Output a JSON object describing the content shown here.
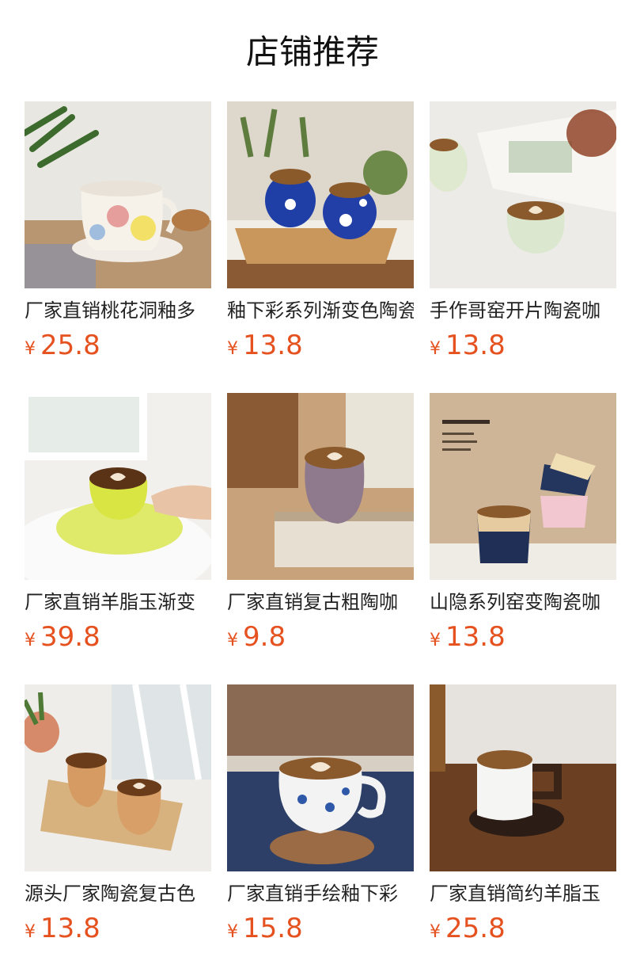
{
  "section": {
    "title": "店铺推荐"
  },
  "currency_symbol": "¥",
  "products": [
    {
      "name": "厂家直销桃花洞釉多",
      "price": "25.8",
      "image": "rainbow-mug-photo"
    },
    {
      "name": "釉下彩系列渐变色陶瓷",
      "price": "13.8",
      "image": "blue-flower-cups-photo"
    },
    {
      "name": "手作哥窑开片陶瓷咖",
      "price": "13.8",
      "image": "celadon-cup-photo"
    },
    {
      "name": "厂家直销羊脂玉渐变",
      "price": "39.8",
      "image": "yellow-cup-saucer-photo"
    },
    {
      "name": "厂家直销复古粗陶咖",
      "price": "9.8",
      "image": "purple-pot-cup-photo"
    },
    {
      "name": "山隐系列窑变陶瓷咖",
      "price": "13.8",
      "image": "stacked-gradient-cups-photo"
    },
    {
      "name": "源头厂家陶瓷复古色",
      "price": "13.8",
      "image": "wooden-tray-cups-photo"
    },
    {
      "name": "厂家直销手绘釉下彩",
      "price": "15.8",
      "image": "blue-floral-mug-photo"
    },
    {
      "name": "厂家直销简约羊脂玉",
      "price": "25.8",
      "image": "white-geometric-mug-photo"
    }
  ]
}
